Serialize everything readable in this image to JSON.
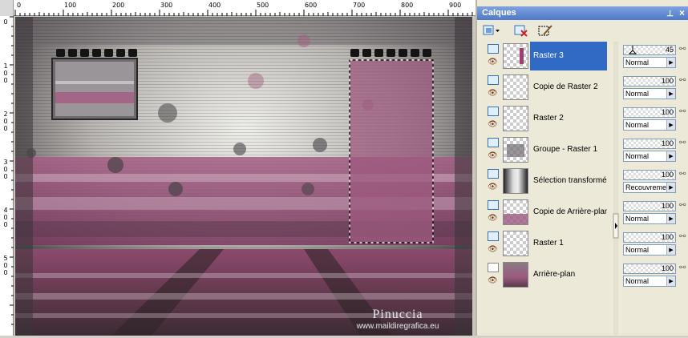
{
  "rulers": {
    "top_ticks": [
      "0",
      "100",
      "200",
      "300",
      "400",
      "500",
      "600",
      "700",
      "800",
      "900"
    ],
    "left_ticks": [
      "0",
      "1 0 0",
      "2 0 0",
      "3 0 0",
      "4 0 0",
      "5 0 0"
    ]
  },
  "watermark": {
    "name": "Pinuccia",
    "url": "www.maildiregrafica.eu"
  },
  "palette": {
    "title": "Calques",
    "layers": [
      {
        "name": "Raster 3",
        "opacity": "45",
        "blend": "Normal",
        "selected": true
      },
      {
        "name": "Copie de Raster 2",
        "opacity": "100",
        "blend": "Normal",
        "selected": false
      },
      {
        "name": "Raster 2",
        "opacity": "100",
        "blend": "Normal",
        "selected": false
      },
      {
        "name": "Groupe - Raster 1",
        "opacity": "100",
        "blend": "Normal",
        "selected": false
      },
      {
        "name": "Sélection transformée",
        "opacity": "100",
        "blend": "Recouvrement",
        "selected": false
      },
      {
        "name": "Copie de Arrière-plan",
        "opacity": "100",
        "blend": "Normal",
        "selected": false
      },
      {
        "name": "Raster 1",
        "opacity": "100",
        "blend": "Normal",
        "selected": false
      },
      {
        "name": "Arrière-plan",
        "opacity": "100",
        "blend": "Normal",
        "selected": false
      }
    ]
  },
  "colors": {
    "accent": "#b0547f",
    "selection": "#316ac5",
    "title_bar": "#5a82cc"
  },
  "icons": {
    "eye": "eye-icon",
    "link": "link-icon",
    "pin": "pin-icon",
    "close": "close-icon"
  }
}
